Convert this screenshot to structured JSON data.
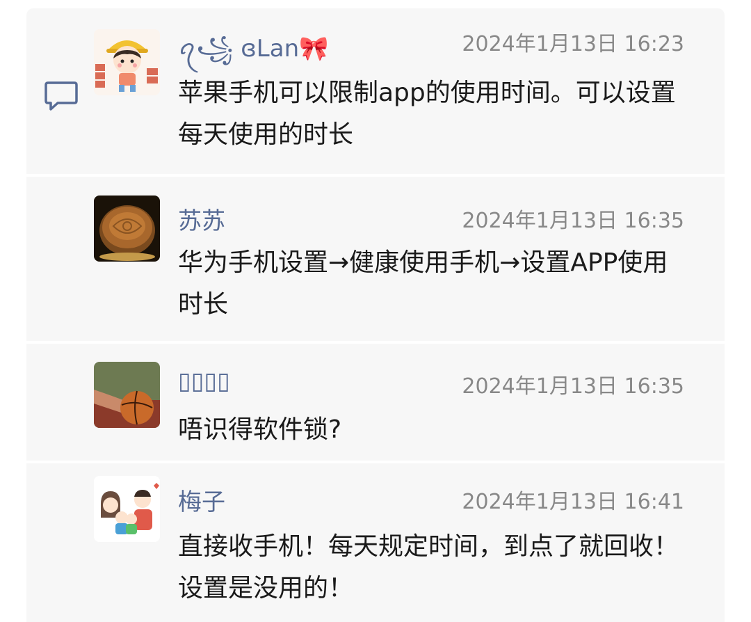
{
  "comments": [
    {
      "author": "ꪖ꧁ ɞLan🎀",
      "time": "2024年1月13日 16:23",
      "text": "苹果手机可以限制app的使用时间。可以设置每天使用的时长"
    },
    {
      "author": "苏苏",
      "time": "2024年1月13日 16:35",
      "text": "华为手机设置→健康使用手机→设置APP使用时长"
    },
    {
      "author": "▯▯▯▯",
      "time": "2024年1月13日 16:35",
      "text": "唔识得软件锁?"
    },
    {
      "author": "梅子",
      "time": "2024年1月13日 16:41",
      "text": "直接收手机！每天规定时间，到点了就回收！设置是没用的！"
    }
  ],
  "icons": {
    "comment_section": "comment-bubble-icon"
  },
  "colors": {
    "author_name": "#576b95",
    "timestamp": "#888888",
    "panel_background": "#f7f7f7"
  }
}
